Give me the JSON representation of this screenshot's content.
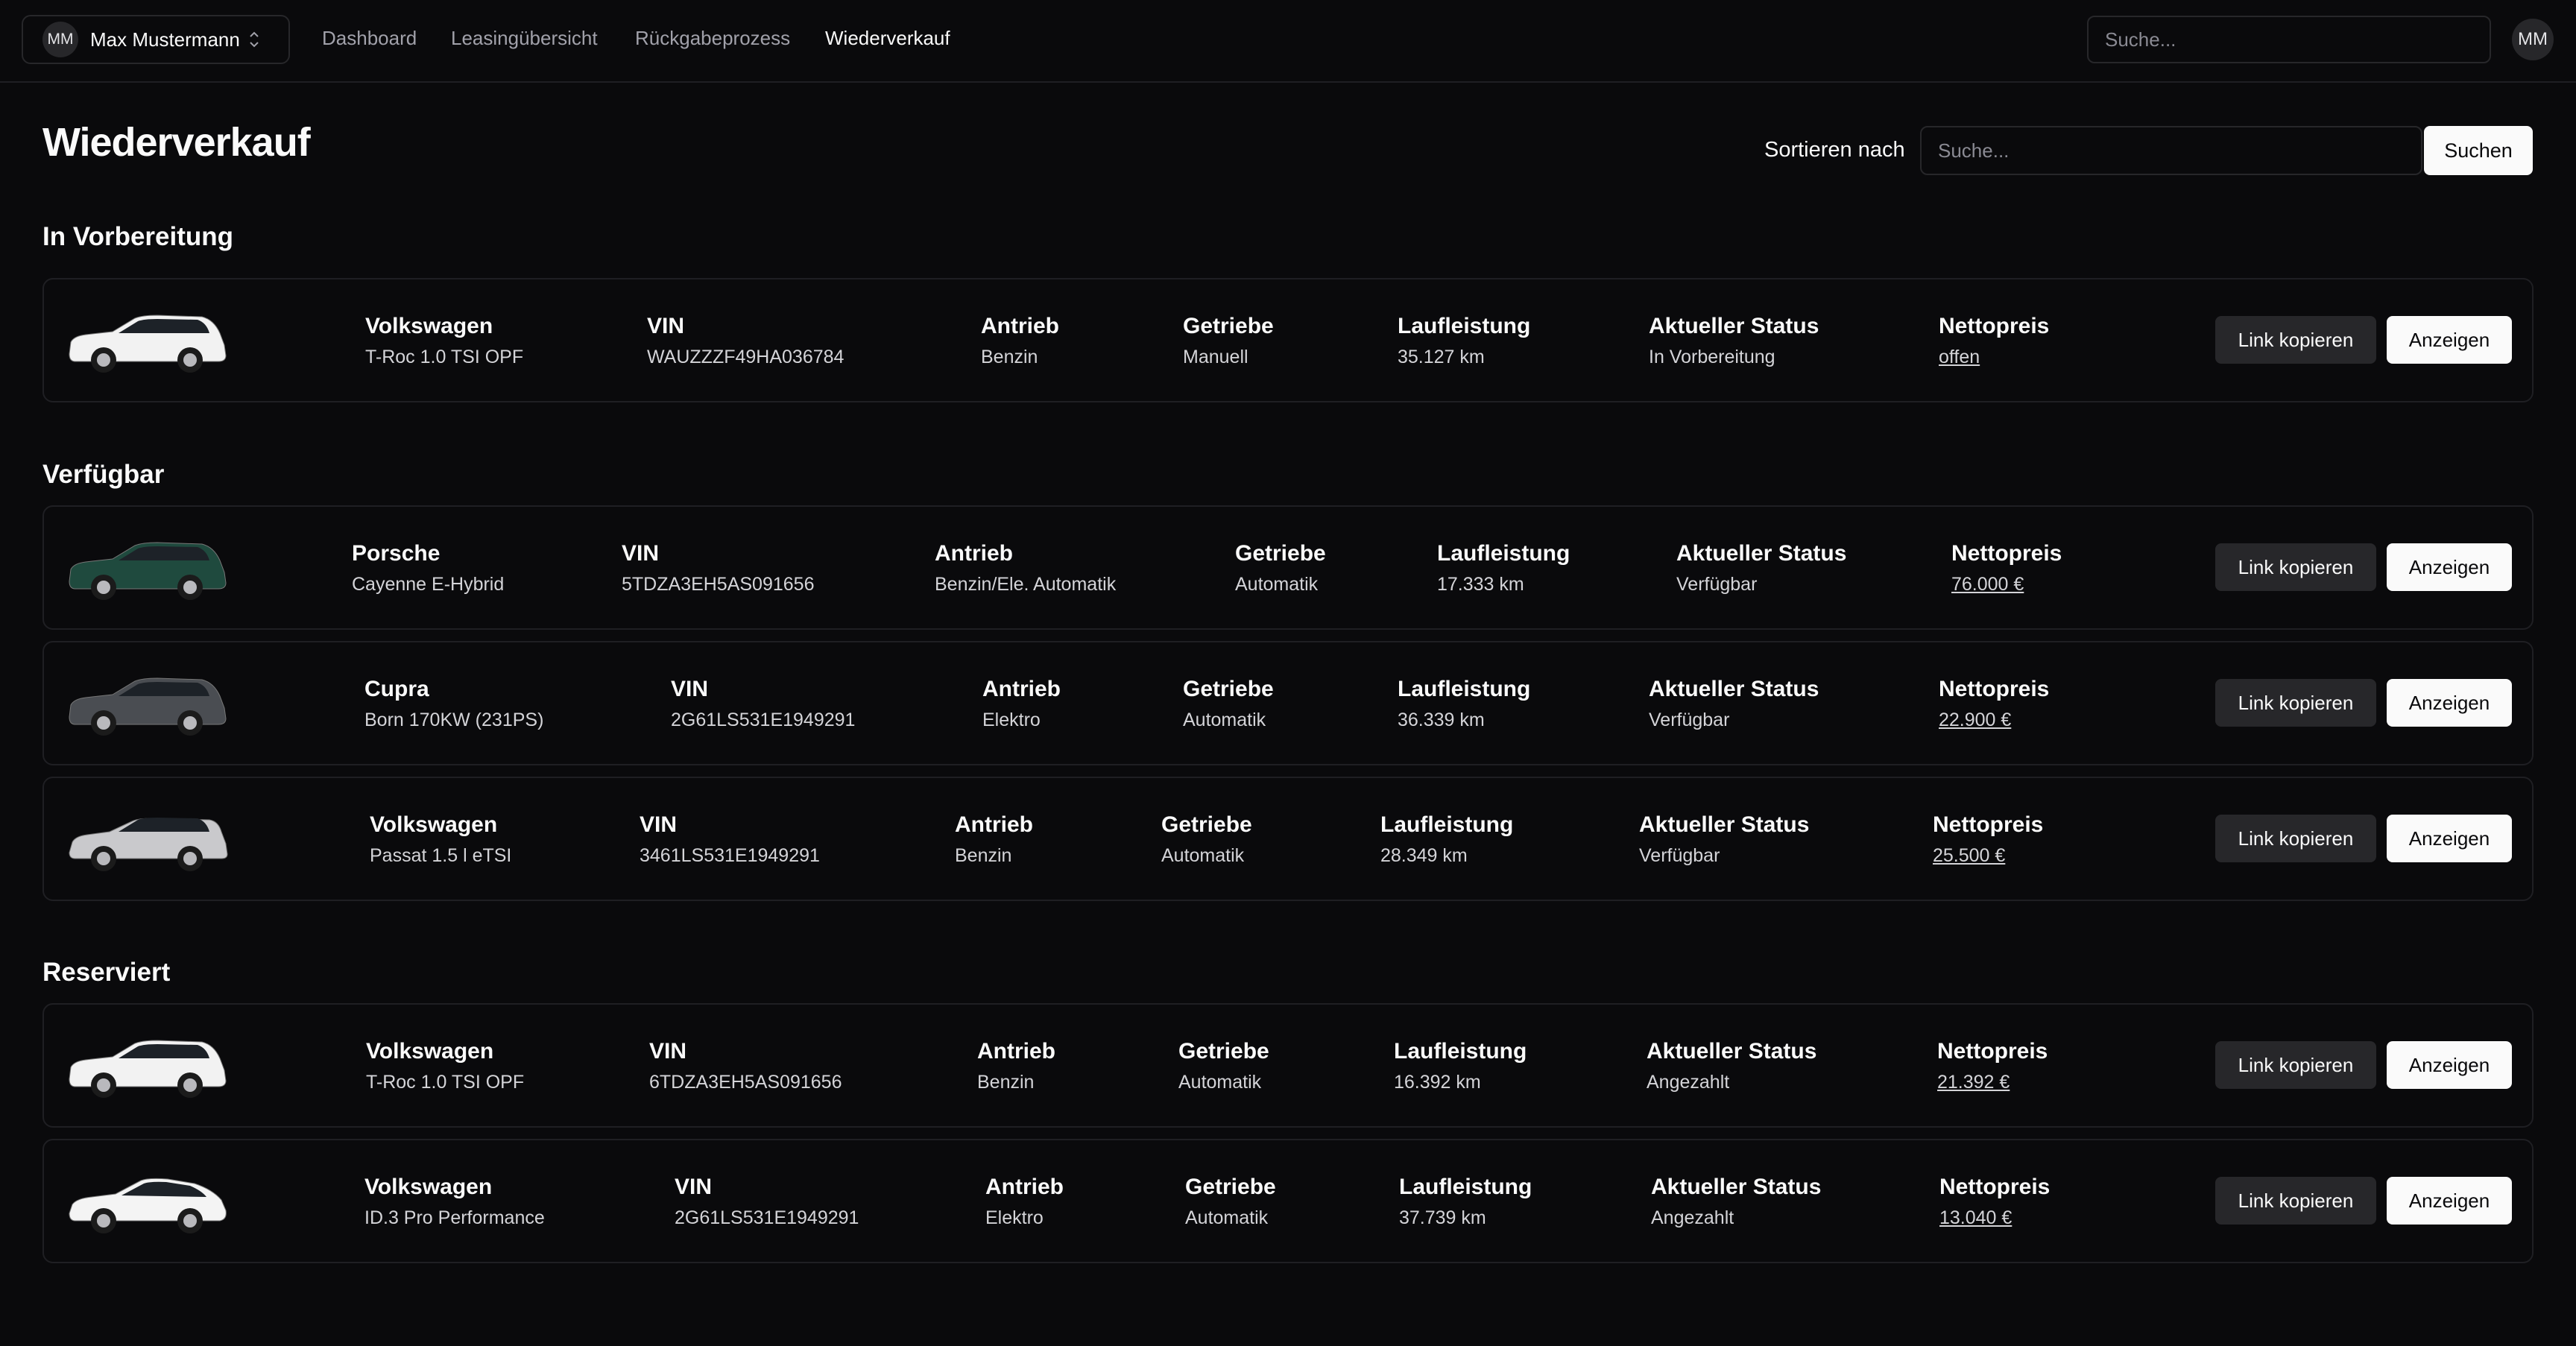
{
  "header": {
    "account": {
      "initials": "MM",
      "name": "Max Mustermann"
    },
    "nav": [
      "Dashboard",
      "Leasingübersicht",
      "Rückgabeprozess",
      "Wiederverkauf"
    ],
    "active_nav": "Wiederverkauf",
    "search_placeholder": "Suche...",
    "user_initials": "MM"
  },
  "page": {
    "title": "Wiederverkauf",
    "sort_label": "Sortieren nach",
    "sort_placeholder": "Suche...",
    "search_button": "Suchen"
  },
  "labels": {
    "vin": "VIN",
    "drive": "Antrieb",
    "gearbox": "Getriebe",
    "mileage": "Laufleistung",
    "status": "Aktueller Status",
    "price": "Nettopreis",
    "copy_link": "Link kopieren",
    "show": "Anzeigen"
  },
  "sections": [
    {
      "title": "In Vorbereitung",
      "cars": [
        {
          "brand": "Volkswagen",
          "model": "T-Roc 1.0 TSI OPF",
          "vin": "WAUZZZF49HA036784",
          "drive": "Benzin",
          "gearbox": "Manuell",
          "mileage": "35.127 km",
          "status": "In Vorbereitung",
          "price": "offen",
          "color": "#f2f2f2",
          "shape": "suv"
        }
      ]
    },
    {
      "title": "Verfügbar",
      "cars": [
        {
          "brand": "Porsche",
          "model": "Cayenne E-Hybrid",
          "vin": "5TDZA3EH5AS091656",
          "drive": "Benzin/Ele. Automatik",
          "gearbox": "Automatik",
          "mileage": "17.333 km",
          "status": "Verfügbar",
          "price": "76.000 €",
          "color": "#1f4a3e",
          "shape": "suv"
        },
        {
          "brand": "Cupra",
          "model": "Born 170KW (231PS)",
          "vin": "2G61LS531E1949291",
          "drive": "Elektro",
          "gearbox": "Automatik",
          "mileage": "36.339 km",
          "status": "Verfügbar",
          "price": "22.900 €",
          "color": "#4a4d52",
          "shape": "suv"
        },
        {
          "brand": "Volkswagen",
          "model": "Passat 1.5 l eTSI",
          "vin": "3461LS531E1949291",
          "drive": "Benzin",
          "gearbox": "Automatik",
          "mileage": "28.349 km",
          "status": "Verfügbar",
          "price": "25.500 €",
          "color": "#c9c9cc",
          "shape": "wagon"
        }
      ]
    },
    {
      "title": "Reserviert",
      "cars": [
        {
          "brand": "Volkswagen",
          "model": "T-Roc 1.0 TSI OPF",
          "vin": "6TDZA3EH5AS091656",
          "drive": "Benzin",
          "gearbox": "Automatik",
          "mileage": "16.392 km",
          "status": "Angezahlt",
          "price": "21.392 €",
          "color": "#f2f2f2",
          "shape": "suv"
        },
        {
          "brand": "Volkswagen",
          "model": "ID.3 Pro Performance",
          "vin": "2G61LS531E1949291",
          "drive": "Elektro",
          "gearbox": "Automatik",
          "mileage": "37.739 km",
          "status": "Angezahlt",
          "price": "13.040 €",
          "color": "#f4f4f4",
          "shape": "coupe"
        }
      ]
    }
  ]
}
